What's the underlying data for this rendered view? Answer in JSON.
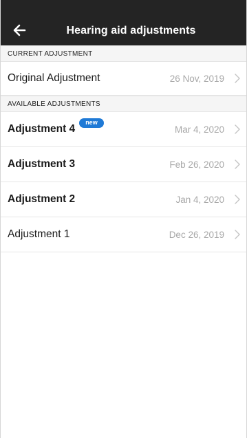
{
  "header": {
    "title": "Hearing aid adjustments",
    "back_icon": "arrow-left-icon"
  },
  "sections": {
    "current": {
      "title": "CURRENT ADJUSTMENT",
      "item": {
        "label": "Original Adjustment",
        "date": "26 Nov, 2019"
      }
    },
    "available": {
      "title": "AVAILABLE ADJUSTMENTS",
      "items": [
        {
          "label": "Adjustment 4",
          "date": "Mar 4, 2020",
          "badge": "new",
          "bold": true
        },
        {
          "label": "Adjustment 3",
          "date": "Feb 26, 2020",
          "bold": true
        },
        {
          "label": "Adjustment 2",
          "date": "Jan 4, 2020",
          "bold": true
        },
        {
          "label": "Adjustment 1",
          "date": "Dec 26, 2019",
          "bold": false
        }
      ]
    }
  },
  "colors": {
    "header_bg": "#242424",
    "badge_bg": "#1f7ad6",
    "date_text": "#a8a8a8",
    "section_bg": "#f5f5f5"
  },
  "icons": {
    "row_chevron": "chevron-right-icon"
  }
}
